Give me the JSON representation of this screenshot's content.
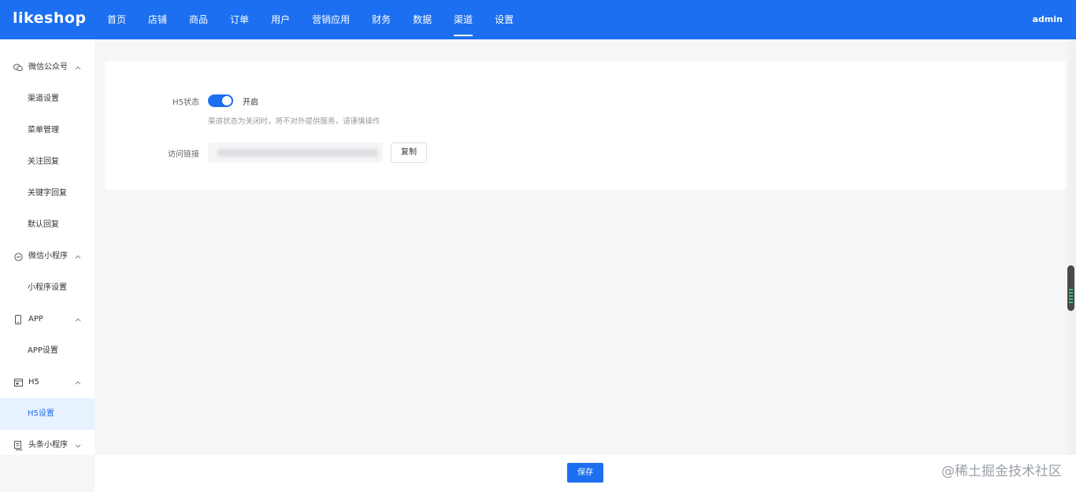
{
  "header": {
    "logo": "likeshop",
    "nav": [
      "首页",
      "店铺",
      "商品",
      "订单",
      "用户",
      "营销应用",
      "财务",
      "数据",
      "渠道",
      "设置"
    ],
    "active_nav": "渠道",
    "user": "admin"
  },
  "sidebar": {
    "groups": [
      {
        "label": "微信公众号",
        "icon": "wechat-icon",
        "expanded": true,
        "items": [
          "渠道设置",
          "菜单管理",
          "关注回复",
          "关键字回复",
          "默认回复"
        ]
      },
      {
        "label": "微信小程序",
        "icon": "mini-program-icon",
        "expanded": true,
        "items": [
          "小程序设置"
        ]
      },
      {
        "label": "APP",
        "icon": "phone-icon",
        "expanded": true,
        "items": [
          "APP设置"
        ]
      },
      {
        "label": "H5",
        "icon": "h5-icon",
        "expanded": true,
        "items": [
          "H5设置"
        ]
      },
      {
        "label": "头条小程序",
        "icon": "toutiao-icon",
        "expanded": false,
        "items": []
      }
    ],
    "active_item": "H5设置"
  },
  "form": {
    "status_label": "H5状态",
    "status_on": true,
    "status_text": "开启",
    "status_hint": "渠道状态为关闭时，将不对外提供服务，请谨慎操作",
    "url_label": "访问链接",
    "copy_label": "复制"
  },
  "footer": {
    "save_label": "保存",
    "watermark": "@稀土掘金技术社区"
  },
  "colors": {
    "primary": "#1c6ff0",
    "background": "#f5f6f8",
    "sidebar_active_bg": "#e8f1fe"
  }
}
